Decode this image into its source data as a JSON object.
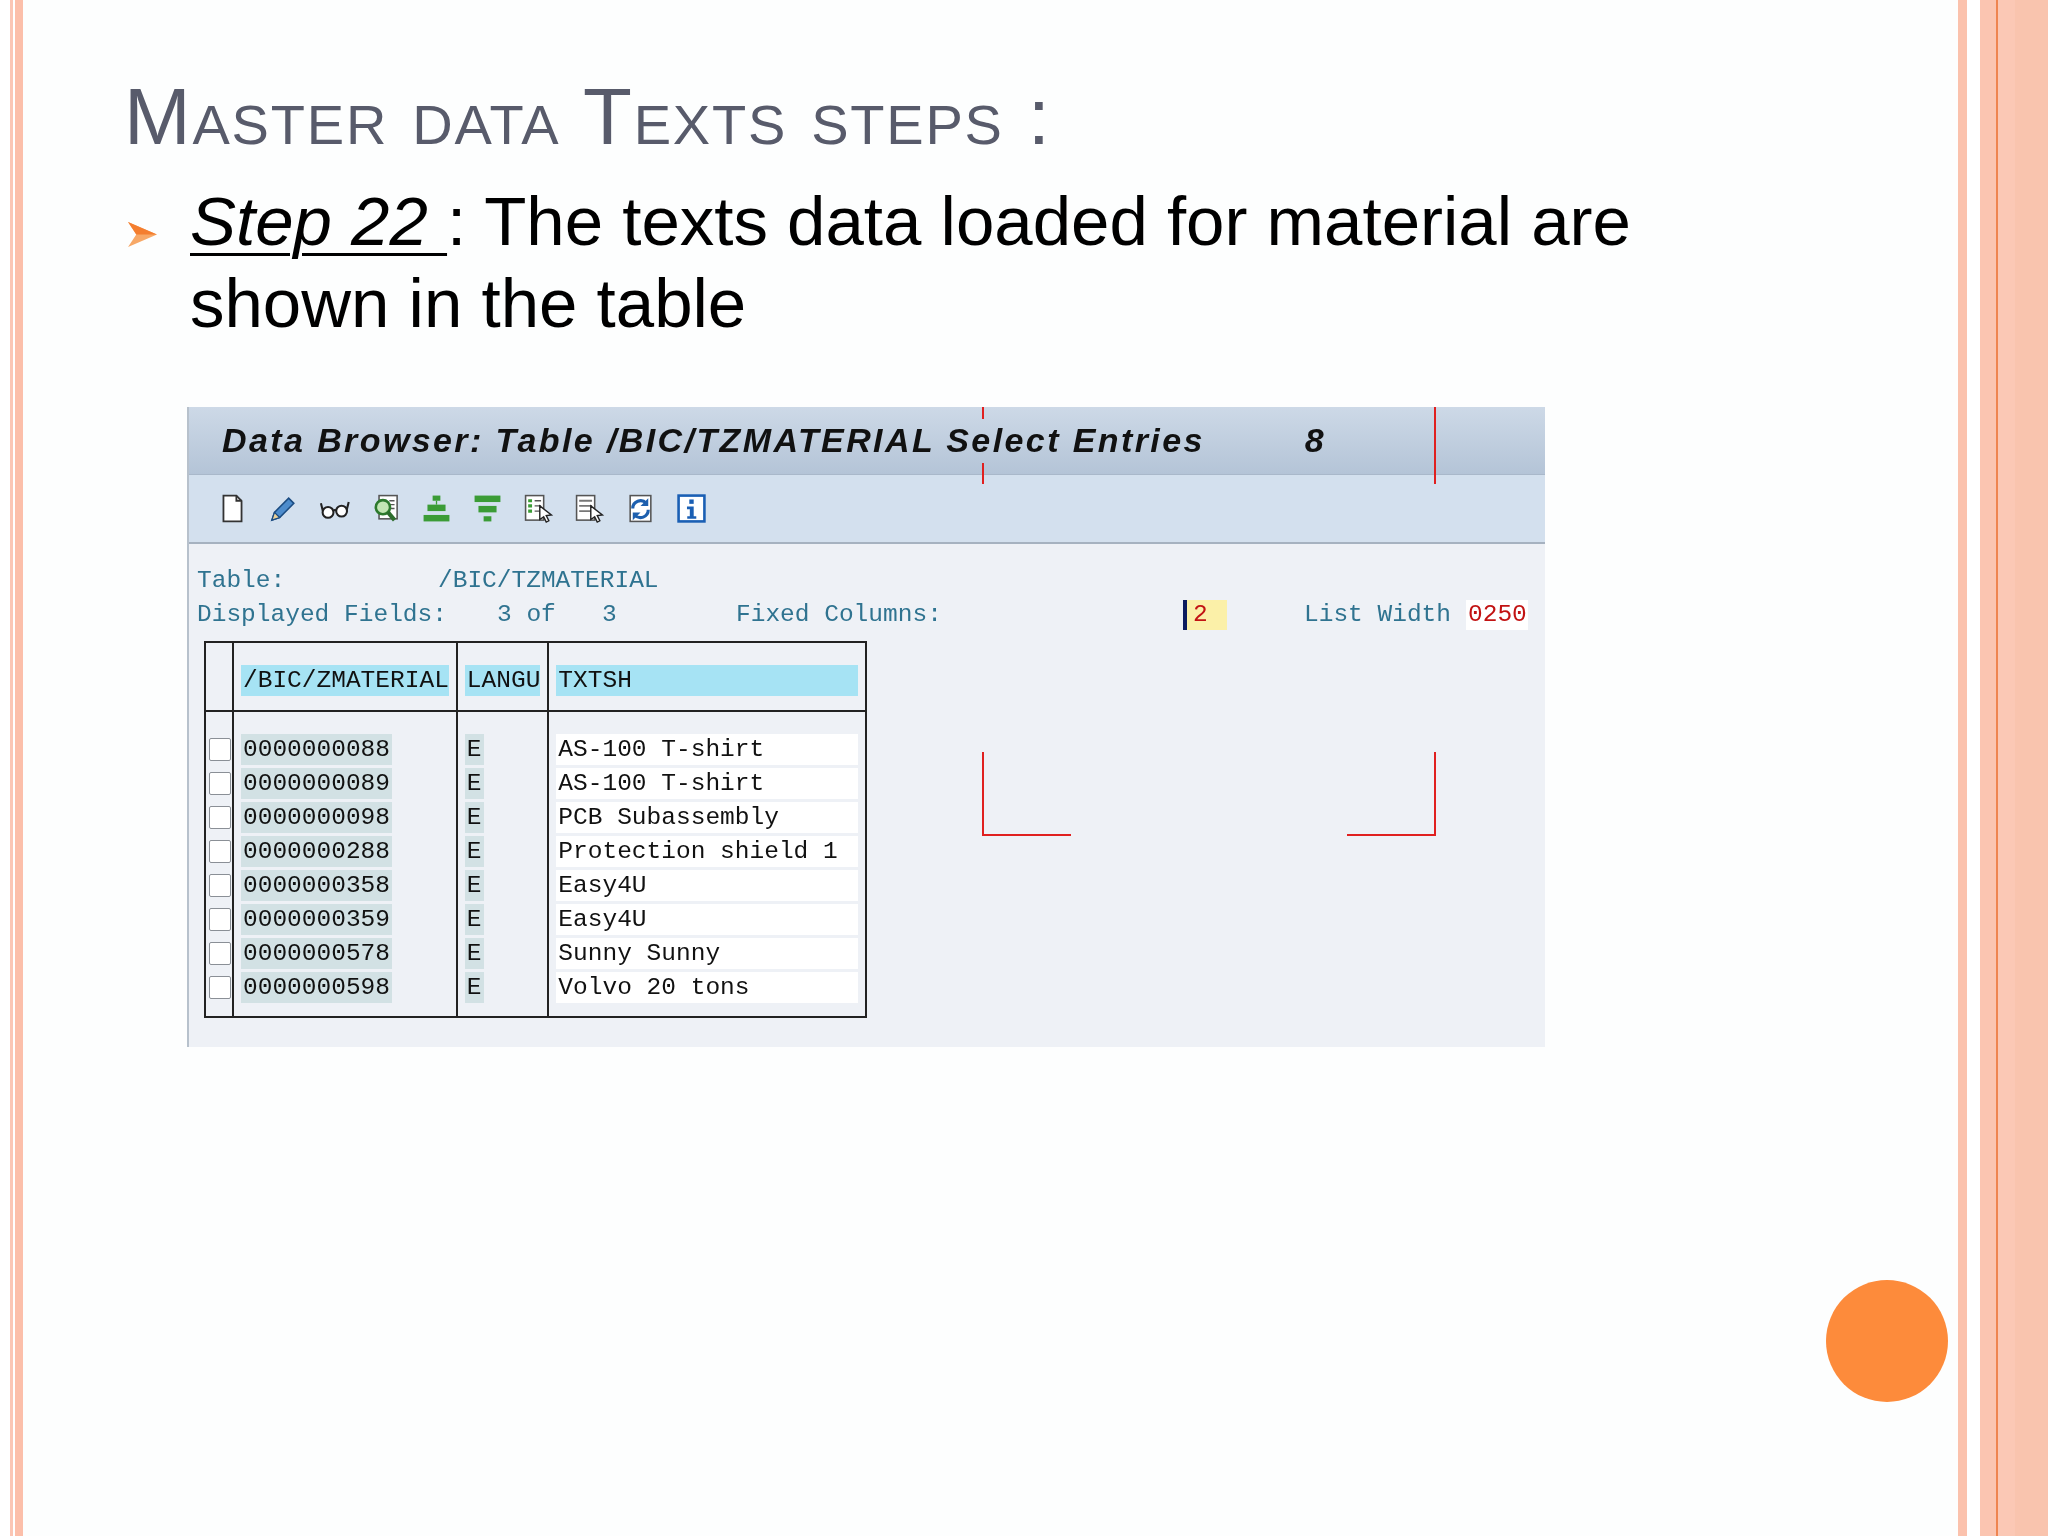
{
  "slide": {
    "title": "Master data Texts steps :"
  },
  "bullet": {
    "label": "Step 22 ",
    "text": ": The texts data loaded for material are shown in the table"
  },
  "sap_window": {
    "title": "Data Browser: Table /BIC/TZMATERIAL Select Entries",
    "entry_count": "8",
    "selection_info": {
      "table_label": "Table:",
      "table_name": "/BIC/TZMATERIAL",
      "fields_label": "Displayed Fields:",
      "fields_shown": "3 of",
      "fields_total": "3",
      "fixed_columns_label": "Fixed Columns:",
      "fixed_columns_value": "2",
      "fixed_columns_focused": true,
      "list_width_label": "List Width",
      "list_width_value": "0250"
    },
    "table": {
      "columns": [
        "/BIC/ZMATERIAL",
        "LANGU",
        "TXTSH"
      ],
      "rows": [
        {
          "checked": false,
          "cells": [
            "0000000088",
            "E",
            "AS-100 T-shirt"
          ]
        },
        {
          "checked": false,
          "cells": [
            "0000000089",
            "E",
            "AS-100 T-shirt"
          ]
        },
        {
          "checked": false,
          "cells": [
            "0000000098",
            "E",
            "PCB Subassembly"
          ]
        },
        {
          "checked": false,
          "cells": [
            "0000000288",
            "E",
            "Protection shield 1"
          ]
        },
        {
          "checked": false,
          "cells": [
            "0000000358",
            "E",
            "Easy4U"
          ]
        },
        {
          "checked": false,
          "cells": [
            "0000000359",
            "E",
            "Easy4U"
          ]
        },
        {
          "checked": false,
          "cells": [
            "0000000578",
            "E",
            "Sunny Sunny"
          ]
        },
        {
          "checked": false,
          "cells": [
            "0000000598",
            "E",
            "Volvo 20 tons"
          ]
        }
      ]
    }
  }
}
